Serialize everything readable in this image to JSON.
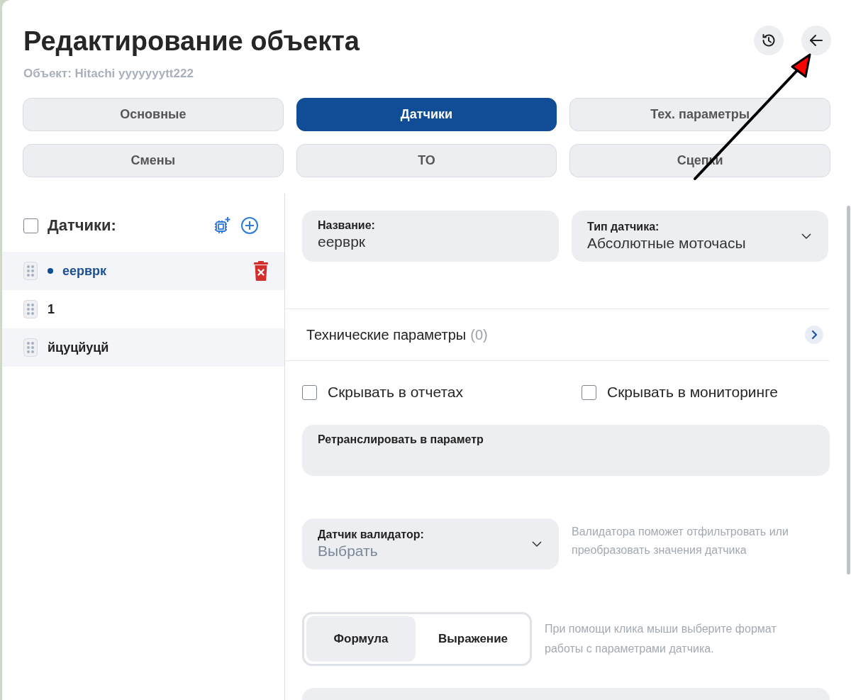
{
  "header": {
    "title": "Редактирование объекта",
    "subtitle": "Объект: Hitachi yyyyyyytt222"
  },
  "tabs": [
    {
      "label": "Основные",
      "selected": false
    },
    {
      "label": "Датчики",
      "selected": true
    },
    {
      "label": "Тех. параметры",
      "selected": false
    },
    {
      "label": "Смены",
      "selected": false
    },
    {
      "label": "ТО",
      "selected": false
    },
    {
      "label": "Сцепки",
      "selected": false
    }
  ],
  "sensors": {
    "title": "Датчики:",
    "all_checked": false,
    "items": [
      {
        "label": "еерврк",
        "selected": true
      },
      {
        "label": "1",
        "selected": false
      },
      {
        "label": "йцуцйуцй",
        "selected": false
      }
    ]
  },
  "form": {
    "name_field": {
      "label": "Название:",
      "value": "еерврк"
    },
    "type_field": {
      "label": "Тип датчика:",
      "value": "Абсолютные моточасы"
    },
    "tech_params": {
      "label": "Технические параметры",
      "count": "(0)"
    },
    "checkboxes": [
      {
        "label": "Скрывать в отчетах",
        "checked": false
      },
      {
        "label": "Скрывать в мониторинге",
        "checked": false
      }
    ],
    "relay_field": {
      "label": "Ретранслировать в параметр"
    },
    "validator_field": {
      "label": "Датчик валидатор:",
      "placeholder": "Выбрать",
      "hint": "Валидатора поможет отфильтровать или преобразовать значения датчика"
    },
    "mode_switch": {
      "options": [
        {
          "label": "Формула",
          "selected": true
        },
        {
          "label": "Выражение",
          "selected": false
        }
      ],
      "hint": "При помощи клика мыши выберите формат работы с параметрами датчика."
    }
  }
}
